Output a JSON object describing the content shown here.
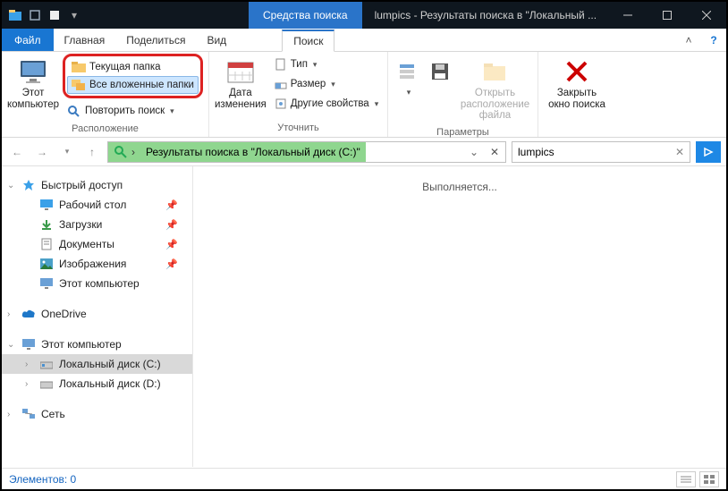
{
  "titlebar": {
    "context_tab": "Средства поиска",
    "window_title": "lumpics - Результаты поиска в \"Локальный ..."
  },
  "tabs": {
    "file": "Файл",
    "home": "Главная",
    "share": "Поделиться",
    "view": "Вид",
    "search": "Поиск"
  },
  "ribbon": {
    "this_pc": "Этот\nкомпьютер",
    "current_folder": "Текущая папка",
    "all_subfolders": "Все вложенные папки",
    "search_again": "Повторить поиск",
    "group_location": "Расположение",
    "date_modified": "Дата\nизменения",
    "type": "Тип",
    "size": "Размер",
    "other_props": "Другие свойства",
    "group_refine": "Уточнить",
    "open_location": "Открыть\nрасположение файла",
    "group_params": "Параметры",
    "close_search": "Закрыть\nокно поиска"
  },
  "address": {
    "breadcrumb": "Результаты поиска в \"Локальный диск (C:)\""
  },
  "search": {
    "value": "lumpics"
  },
  "sidebar": {
    "quick_access": "Быстрый доступ",
    "desktop": "Рабочий стол",
    "downloads": "Загрузки",
    "documents": "Документы",
    "pictures": "Изображения",
    "this_pc_item": "Этот компьютер",
    "onedrive": "OneDrive",
    "this_pc2": "Этот компьютер",
    "disk_c": "Локальный диск (C:)",
    "disk_d": "Локальный диск (D:)",
    "network": "Сеть"
  },
  "content": {
    "status_text": "Выполняется..."
  },
  "statusbar": {
    "items": "Элементов: 0"
  }
}
